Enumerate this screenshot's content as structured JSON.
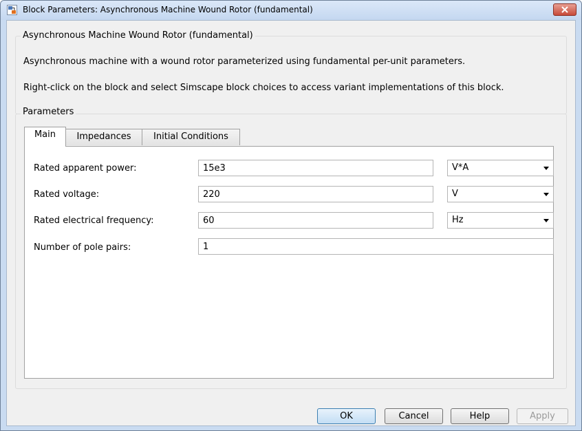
{
  "window": {
    "title": "Block Parameters: Asynchronous Machine Wound Rotor (fundamental)"
  },
  "block": {
    "group_title": "Asynchronous Machine Wound Rotor (fundamental)",
    "description": "Asynchronous machine with a wound rotor parameterized using fundamental per-unit parameters.",
    "hint": "Right-click on the block and select Simscape block choices to access variant implementations of this block."
  },
  "parameters": {
    "group_title": "Parameters",
    "tabs": [
      {
        "label": "Main",
        "active": true
      },
      {
        "label": "Impedances",
        "active": false
      },
      {
        "label": "Initial Conditions",
        "active": false
      }
    ],
    "rows": [
      {
        "label": "Rated apparent power:",
        "value": "15e3",
        "unit": "V*A"
      },
      {
        "label": "Rated voltage:",
        "value": "220",
        "unit": "V"
      },
      {
        "label": "Rated electrical frequency:",
        "value": "60",
        "unit": "Hz"
      },
      {
        "label": "Number of pole pairs:",
        "value": "1"
      }
    ]
  },
  "buttons": {
    "ok": "OK",
    "cancel": "Cancel",
    "help": "Help",
    "apply": "Apply"
  },
  "colors": {
    "title_bar": "#c4d7f0",
    "close_button": "#c74a3a",
    "dialog_background": "#f0f0f0",
    "default_button": "#c3def4"
  },
  "icons": {
    "window": "simulink-block-icon",
    "close": "close-icon",
    "dropdown": "chevron-down-icon"
  }
}
